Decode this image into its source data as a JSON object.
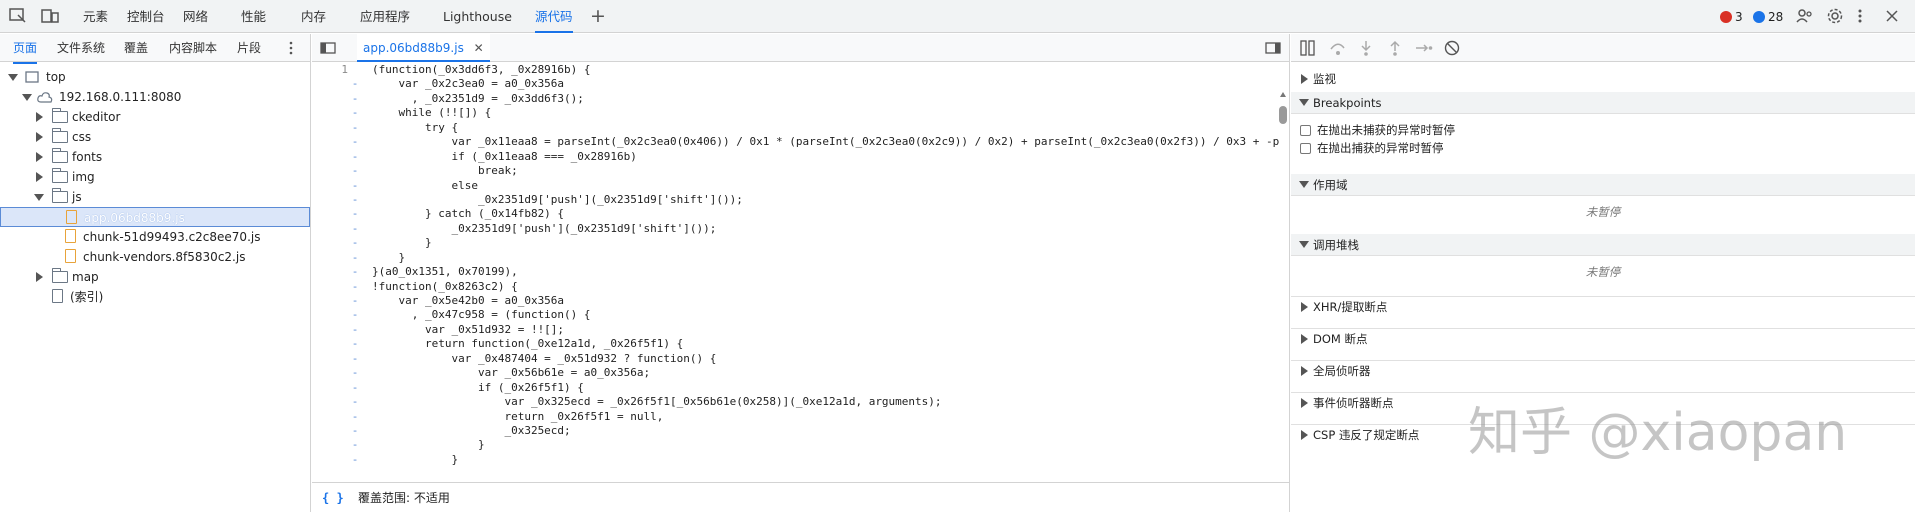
{
  "main_tabs": [
    "元素",
    "控制台",
    "网络",
    "性能",
    "内存",
    "应用程序",
    "Lighthouse",
    "源代码"
  ],
  "errors": "3",
  "messages": "28",
  "left_tabs": [
    "页面",
    "文件系统",
    "覆盖",
    "内容脚本",
    "片段"
  ],
  "tree": [
    {
      "label": "top"
    },
    {
      "label": "192.168.0.111:8080"
    },
    {
      "label": "ckeditor"
    },
    {
      "label": "css"
    },
    {
      "label": "fonts"
    },
    {
      "label": "img"
    },
    {
      "label": "js"
    },
    {
      "label": "app.06bd88b9.js"
    },
    {
      "label": "chunk-51d99493.c2c8ee70.js"
    },
    {
      "label": "chunk-vendors.8f5830c2.js"
    },
    {
      "label": "map"
    },
    {
      "label": "(索引)"
    }
  ],
  "editor_tab": "app.06bd88b9.js",
  "first_line_number": "1",
  "code_lines": [
    "(function(_0x3dd6f3, _0x28916b) {",
    "    var _0x2c3ea0 = a0_0x356a",
    "      , _0x2351d9 = _0x3dd6f3();",
    "    while (!![]) {",
    "        try {",
    "            var _0x11eaa8 = parseInt(_0x2c3ea0(0x406)) / 0x1 * (parseInt(_0x2c3ea0(0x2c9)) / 0x2) + parseInt(_0x2c3ea0(0x2f3)) / 0x3 + -p",
    "            if (_0x11eaa8 === _0x28916b)",
    "                break;",
    "            else",
    "                _0x2351d9['push'](_0x2351d9['shift']());",
    "        } catch (_0x14fb82) {",
    "            _0x2351d9['push'](_0x2351d9['shift']());",
    "        }",
    "    }",
    "}(a0_0x1351, 0x70199),",
    "!function(_0x8263c2) {",
    "    var _0x5e42b0 = a0_0x356a",
    "      , _0x47c958 = (function() {",
    "        var _0x51d932 = !![];",
    "        return function(_0xe12a1d, _0x26f5f1) {",
    "            var _0x487404 = _0x51d932 ? function() {",
    "                var _0x56b61e = a0_0x356a;",
    "                if (_0x26f5f1) {",
    "                    var _0x325ecd = _0x26f5f1[_0x56b61e(0x258)](_0xe12a1d, arguments);",
    "                    return _0x26f5f1 = null,",
    "                    _0x325ecd;",
    "                }",
    "            }"
  ],
  "status_text": "覆盖范围: 不适用",
  "status_icon": "{ }",
  "right": {
    "watch": "监视",
    "breakpoints": "Breakpoints",
    "bp_uncaught": "在抛出未捕获的异常时暂停",
    "bp_caught": "在抛出捕获的异常时暂停",
    "scope": "作用域",
    "not_paused": "未暂停",
    "callstack": "调用堆栈",
    "not_paused2": "未暂停",
    "xhr": "XHR/提取断点",
    "dom": "DOM 断点",
    "global": "全局侦听器",
    "event": "事件侦听器断点",
    "csp": "CSP 违反了规定断点"
  },
  "watermark": "知乎 @xiaopan",
  "colors": {
    "accent": "#1a73e8",
    "error": "#d93025",
    "message": "#1a73e8"
  }
}
